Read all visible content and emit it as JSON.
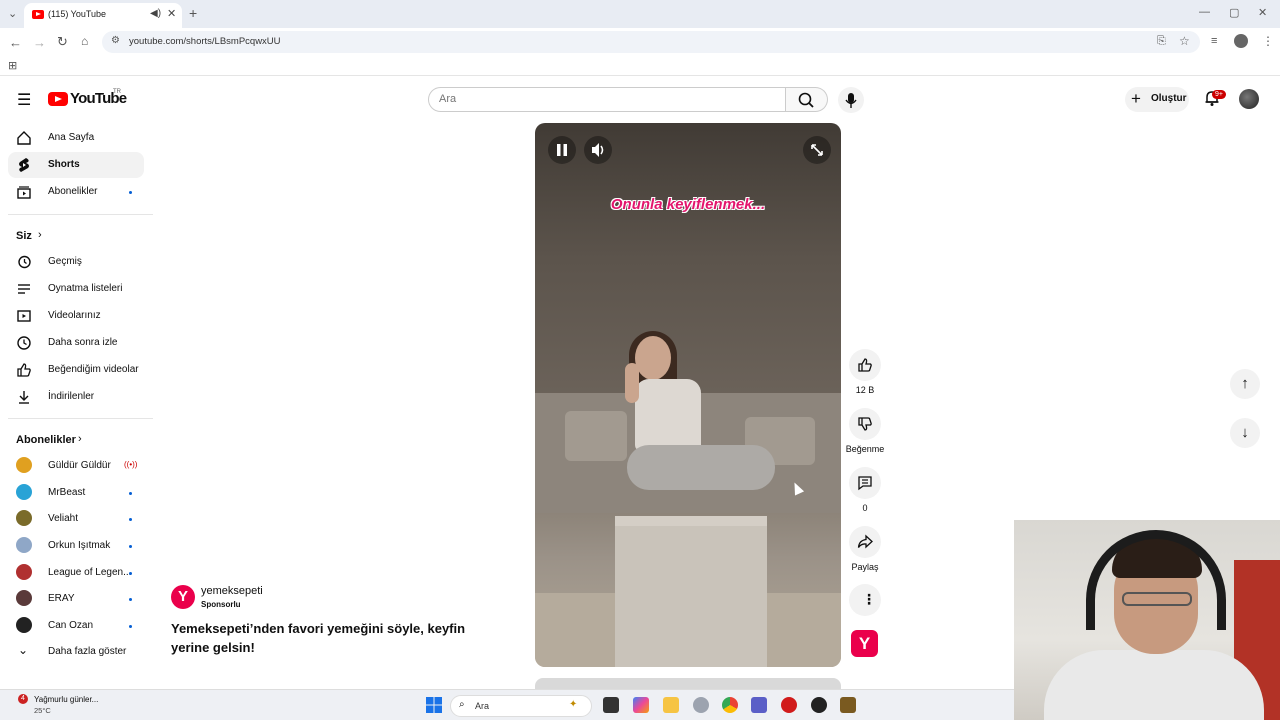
{
  "browser": {
    "tab_title": "(115) YouTube",
    "url": "youtube.com/shorts/LBsmPcqwxUU"
  },
  "header": {
    "logo_text": "YouTube",
    "logo_region": "TR",
    "search_placeholder": "Ara",
    "create_label": "Oluştur",
    "notif_badge": "9+"
  },
  "sidebar": {
    "main": [
      {
        "label": "Ana Sayfa",
        "icon": "home-icon"
      },
      {
        "label": "Shorts",
        "icon": "shorts-icon",
        "active": true
      },
      {
        "label": "Abonelikler",
        "icon": "subscriptions-icon",
        "dot": true
      }
    ],
    "you_title": "Siz",
    "you": [
      {
        "label": "Geçmiş",
        "icon": "history-icon"
      },
      {
        "label": "Oynatma listeleri",
        "icon": "playlist-icon"
      },
      {
        "label": "Videolarınız",
        "icon": "video-icon"
      },
      {
        "label": "Daha sonra izle",
        "icon": "clock-icon"
      },
      {
        "label": "Beğendiğim videolar",
        "icon": "thumb-up-icon"
      },
      {
        "label": "İndirilenler",
        "icon": "download-icon"
      }
    ],
    "subs_title": "Abonelikler",
    "subs": [
      {
        "label": "Güldür Güldür",
        "color": "#e0a020",
        "live": true
      },
      {
        "label": "MrBeast",
        "color": "#29a3d6",
        "dot": true
      },
      {
        "label": "Veliaht",
        "color": "#7a6b2a",
        "dot": true
      },
      {
        "label": "Orkun Işıtmak",
        "color": "#8fa7c7",
        "dot": true
      },
      {
        "label": "League of Legen...",
        "color": "#b03030",
        "dot": true
      },
      {
        "label": "ERAY",
        "color": "#5a3a3a",
        "dot": true
      },
      {
        "label": "Can Ozan",
        "color": "#222222",
        "dot": true
      }
    ],
    "show_more": "Daha fazla göster"
  },
  "video": {
    "caption": "Onunla keyiflenmek..."
  },
  "actions": {
    "likes": "12 B",
    "dislike_label": "Beğenme",
    "comments": "0",
    "share_label": "Paylaş"
  },
  "ad": {
    "channel": "yemeksepeti",
    "sponsored": "Sponsorlu",
    "avatar_letter": "Y",
    "title": "Yemeksepeti’nden favori yemeğini söyle, keyfin yerine gelsin!"
  },
  "taskbar": {
    "weather_line1": "Yağmurlu günler...",
    "weather_line2": "25°C",
    "weather_badge": "4",
    "search_label": "Ara"
  },
  "colors": {
    "youtube_red": "#ff0000",
    "yemeksepeti_pink": "#ea004b",
    "link_blue": "#065fd4"
  }
}
